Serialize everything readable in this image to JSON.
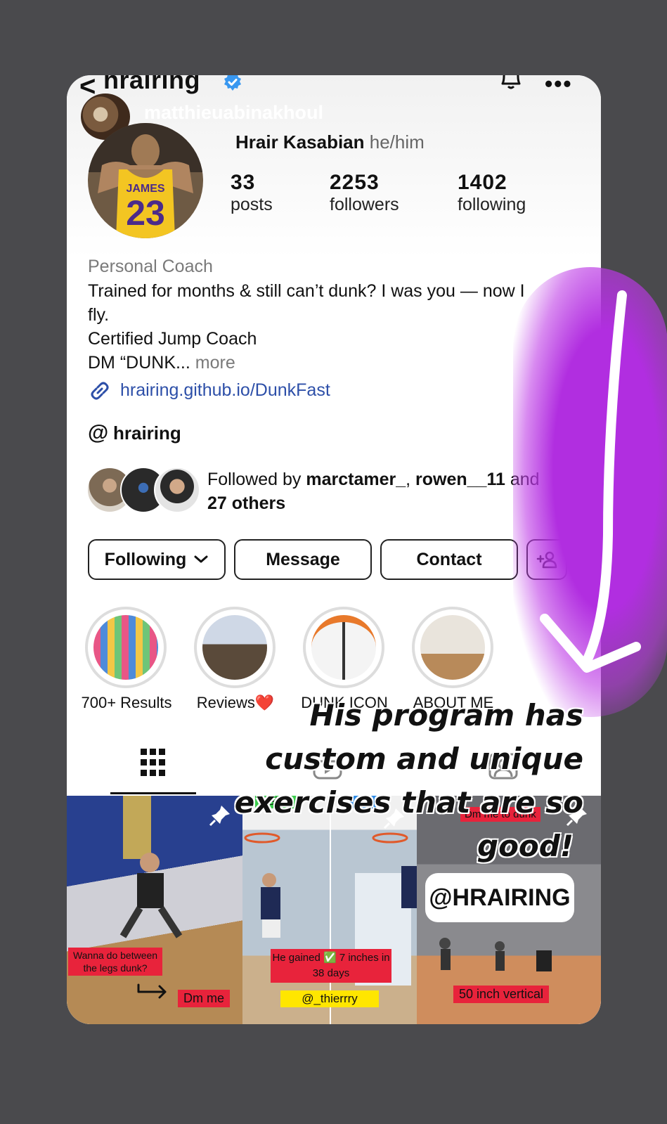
{
  "header": {
    "back_glyph": "<",
    "username": "hrairing",
    "more_glyph": "•••"
  },
  "story": {
    "username": "matthieuabinakhoul"
  },
  "profile": {
    "display_name": "Hrair Kasabian",
    "pronouns": "he/him",
    "stats": [
      {
        "num": "33",
        "label": "posts"
      },
      {
        "num": "2253",
        "label": "followers"
      },
      {
        "num": "1402",
        "label": "following"
      }
    ],
    "category": "Personal Coach",
    "bio_line1": "Trained for months & still can’t dunk? I was you — now I",
    "bio_line2": "fly.",
    "bio_line3": "Certified Jump Coach",
    "bio_line4": "DM “DUNK...",
    "bio_more": "more",
    "link": "hrairing.github.io/DunkFast",
    "threads_glyph": "@",
    "threads_handle": "hrairing"
  },
  "followed_by": {
    "prefix": "Followed by",
    "user1": "marctamer_",
    "sep": ",",
    "user2": "rowen__11",
    "and": "and",
    "others": "27 others"
  },
  "actions": {
    "following": "Following",
    "message": "Message",
    "contact": "Contact"
  },
  "highlights": [
    {
      "label": "700+ Results"
    },
    {
      "label": "Reviews❤️"
    },
    {
      "label": "DUNK ICON"
    },
    {
      "label": "ABOUT ME"
    }
  ],
  "posts": [
    {
      "caption": "Wanna do between the legs dunk?",
      "tag": "Dm me"
    },
    {
      "top_left": "Before",
      "top_right": "After",
      "caption": "He gained ✅ 7 inches in 38 days",
      "tag": "@_thierrry"
    },
    {
      "top": "Dm me to dunk",
      "handle": "@HRAIRING",
      "caption": "50 inch vertical"
    }
  ],
  "overlay": {
    "line1": "His program has",
    "line2": "custom and unique",
    "line3": "exercises that are so",
    "line4": "good!"
  },
  "colors": {
    "glow": "#b12ee0",
    "link": "#2d4fa8",
    "verified": "#3897f0",
    "tag_red": "#e8233b",
    "tag_yellow": "#ffe600"
  }
}
